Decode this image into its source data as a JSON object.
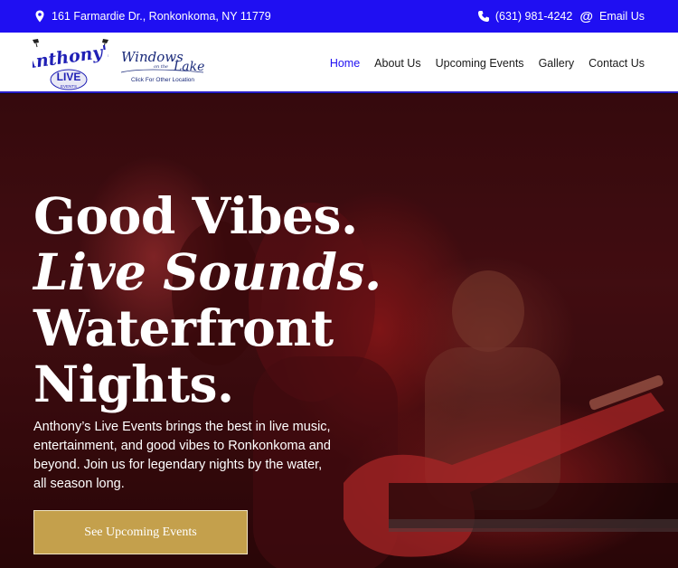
{
  "topbar": {
    "address": "161 Farmardie Dr., Ronkonkoma, NY 11779",
    "phone": "(631) 981-4242",
    "email_label": "Email Us"
  },
  "logos": {
    "anthonys_line1": "Anthony's",
    "anthonys_line2": "LIVE",
    "anthonys_line3": "EVENTS",
    "windows_line1": "Windows",
    "windows_on_the": "on the",
    "windows_line2": "Lake",
    "windows_sub": "Click For Other Location"
  },
  "nav": {
    "items": [
      {
        "label": "Home"
      },
      {
        "label": "About Us"
      },
      {
        "label": "Upcoming Events"
      },
      {
        "label": "Gallery"
      },
      {
        "label": "Contact Us"
      }
    ]
  },
  "hero": {
    "line1": "Good Vibes.",
    "line2": "Live Sounds.",
    "line3": "Waterfront",
    "line4": "Nights.",
    "description": "Anthony’s Live Events brings the best in live music, entertainment, and good vibes to Ronkonkoma and beyond. Join us for legendary nights by the water, all season long.",
    "cta_label": "See Upcoming Events"
  },
  "colors": {
    "topbar_bg": "#1f0ff2",
    "nav_active": "#1f0ff2",
    "cta_bg": "#c4a04c"
  },
  "icons": [
    "location-pin-icon",
    "phone-icon",
    "at-sign-icon"
  ]
}
